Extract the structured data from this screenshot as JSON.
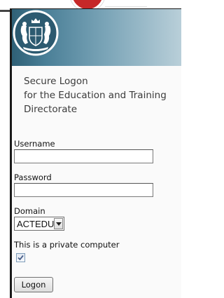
{
  "logon": {
    "crest_icon": "coat-of-arms",
    "heading": {
      "line1": "Secure Logon",
      "line2": "for the Education and Training",
      "line3": "Directorate"
    },
    "username": {
      "label": "Username",
      "value": ""
    },
    "password": {
      "label": "Password",
      "value": ""
    },
    "domain": {
      "label": "Domain",
      "selected": "ACTEDU",
      "dropdown_icon": "chevron-down"
    },
    "private_computer": {
      "label": "This is a private computer",
      "checked": true
    },
    "submit_label": "Logon"
  },
  "colors": {
    "header_dark": "#2f6076",
    "header_light": "#b9cfd9",
    "panel_background": "#fafafa",
    "accent_red": "#c62828"
  }
}
